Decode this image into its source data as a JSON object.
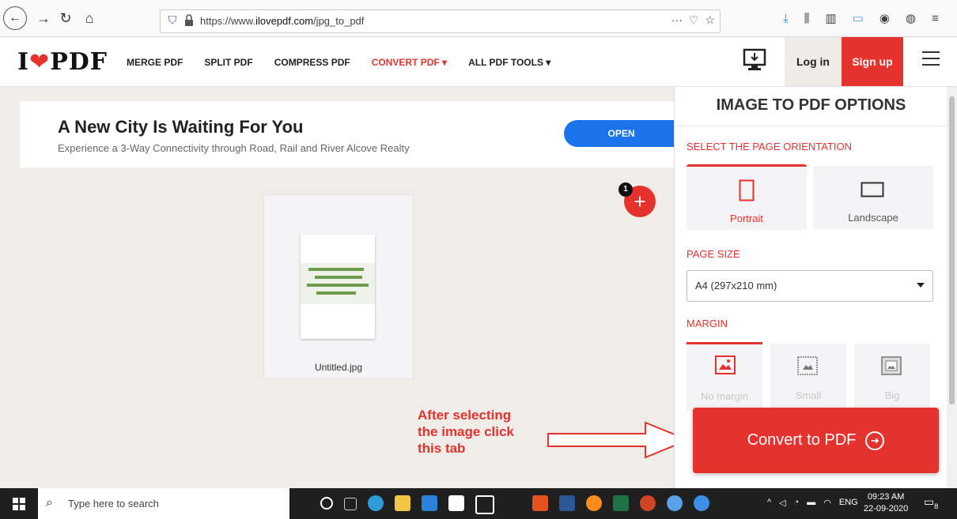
{
  "browser": {
    "url_prefix": "https://www.",
    "url_domain": "ilovepdf.com",
    "url_path": "/jpg_to_pdf",
    "more_icon": "···"
  },
  "site": {
    "logo_left": "I",
    "logo_right": "PDF",
    "menu": [
      "MERGE PDF",
      "SPLIT PDF",
      "COMPRESS PDF",
      "CONVERT PDF ▾",
      "ALL PDF TOOLS ▾"
    ],
    "login_label": "Log in",
    "signup_label": "Sign up"
  },
  "ad": {
    "title": "A New City Is Waiting For You",
    "subtitle": "Experience a 3-Way Connectivity through Road, Rail and River Alcove Realty",
    "button": "OPEN"
  },
  "workspace": {
    "file_name": "Untitled.jpg",
    "file_count": "1",
    "annotation_lines": [
      "After selecting",
      "the image click",
      "this tab"
    ]
  },
  "panel": {
    "title": "IMAGE TO PDF OPTIONS",
    "orientation_label": "SELECT THE PAGE ORIENTATION",
    "orientations": [
      "Portrait",
      "Landscape"
    ],
    "page_size_label": "PAGE SIZE",
    "page_size_value": "A4 (297x210 mm)",
    "margin_label": "MARGIN",
    "margins": [
      "No margin",
      "Small",
      "Big"
    ],
    "convert_label": "Convert to PDF"
  },
  "taskbar": {
    "search_placeholder": "Type here to search",
    "language": "ENG",
    "time": "09:23 AM",
    "date": "22-09-2020",
    "notification_count": "8"
  },
  "colors": {
    "brand_red": "#e5322d",
    "ad_button": "#1a73e8"
  }
}
